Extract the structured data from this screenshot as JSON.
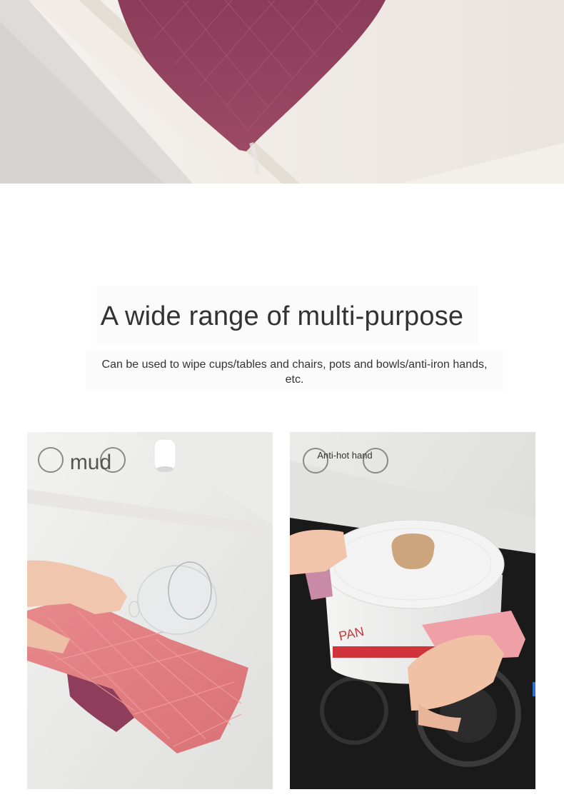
{
  "title": "A wide range of multi-purpose",
  "subtitle": "Can be used to wipe cups/tables and chairs, pots and bowls/anti-iron hands, etc.",
  "cards": [
    {
      "label": "mud"
    },
    {
      "label": "Anti-hot hand",
      "pot_text": "PAN"
    }
  ],
  "colors": {
    "towel_purple": "#8e3d5a",
    "towel_pink": "#e5868a",
    "text": "#333333",
    "sink": "#f0ebe7"
  }
}
